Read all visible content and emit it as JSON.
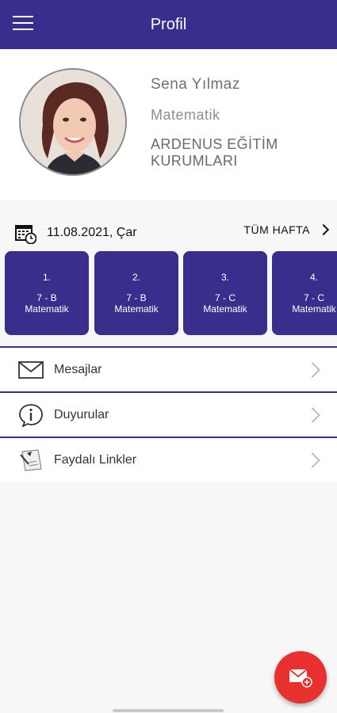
{
  "app_bar": {
    "title": "Profil",
    "menu_icon": "hamburger-menu-icon"
  },
  "profile": {
    "name": "Sena Yılmaz",
    "subject": "Matematik",
    "institution": "ARDENUS EĞİTİM KURUMLARI"
  },
  "schedule": {
    "calendar_icon": "calendar-clock-icon",
    "date": "11.08.2021, Çar",
    "week_link": "TÜM HAFTA",
    "lessons": [
      {
        "number": "1.",
        "class": "7 - B",
        "subject": "Matematik"
      },
      {
        "number": "2.",
        "class": "7 - B",
        "subject": "Matematik"
      },
      {
        "number": "3.",
        "class": "7 - C",
        "subject": "Matematik"
      },
      {
        "number": "4.",
        "class": "7 - C",
        "subject": "Matematik"
      }
    ]
  },
  "menu": [
    {
      "label": "Mesajlar",
      "icon": "envelope-icon"
    },
    {
      "label": "Duyurular",
      "icon": "info-bubble-icon"
    },
    {
      "label": "Faydalı Linkler",
      "icon": "links-note-icon"
    }
  ],
  "fab": {
    "icon": "new-message-icon"
  },
  "colors": {
    "primary": "#3a2e8c",
    "fab": "#e8302f",
    "background": "#f7f7f7"
  }
}
